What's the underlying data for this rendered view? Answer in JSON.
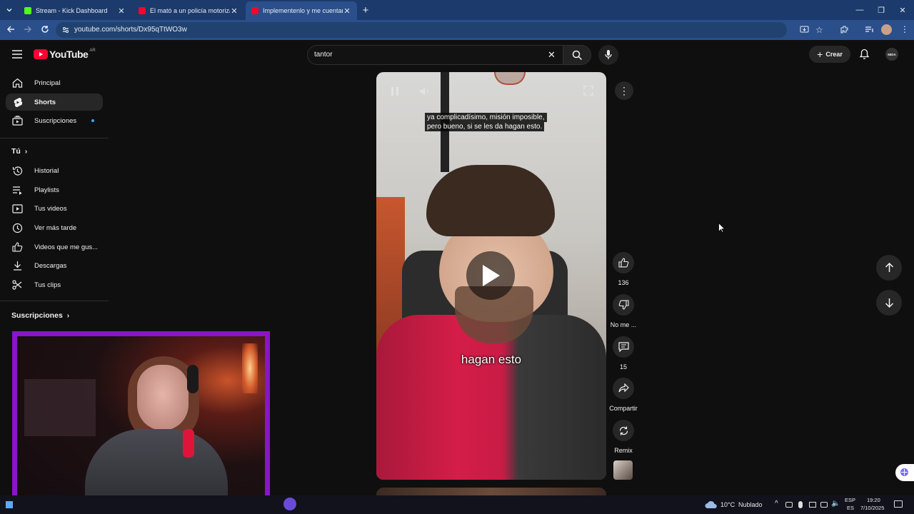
{
  "browser": {
    "tabs": [
      {
        "title": "Stream - Kick Dashboard",
        "favicon_color": "#53fc18"
      },
      {
        "title": "El mató a un policía motorizado",
        "favicon_color": "#ff0033"
      },
      {
        "title": "Implementenlo y me cuentan",
        "favicon_color": "#ff0033"
      }
    ],
    "new_tab_icon": "plus-icon",
    "url": "youtube.com/shorts/Dx95qTtWO3w"
  },
  "youtube": {
    "logo_text": "YouTube",
    "country": "AR",
    "search_value": "tantor",
    "create_label": "Crear",
    "avatar_text": "MIDA"
  },
  "sidebar": {
    "top": [
      {
        "label": "Principal",
        "icon": "home-icon"
      },
      {
        "label": "Shorts",
        "icon": "shorts-icon"
      },
      {
        "label": "Suscripciones",
        "icon": "subscriptions-icon"
      }
    ],
    "you_header": "Tú",
    "you": [
      {
        "label": "Historial",
        "icon": "history-icon"
      },
      {
        "label": "Playlists",
        "icon": "playlists-icon"
      },
      {
        "label": "Tus videos",
        "icon": "your-videos-icon"
      },
      {
        "label": "Ver más tarde",
        "icon": "watch-later-icon"
      },
      {
        "label": "Videos que me gus...",
        "icon": "liked-icon"
      },
      {
        "label": "Descargas",
        "icon": "download-icon"
      },
      {
        "label": "Tus clips",
        "icon": "clips-icon"
      }
    ],
    "subs_header": "Suscripciones"
  },
  "short": {
    "caption_line1": "ya complicadísimo, misión imposible,",
    "caption_line2": "pero bueno, si se les da hagan esto.",
    "subtitle": "hagan esto",
    "likes": "136",
    "dislike_label": "No me ...",
    "comments": "15",
    "share_label": "Compartir",
    "remix_label": "Remix"
  },
  "taskbar": {
    "temp": "10°C",
    "weather": "Nublado",
    "lang1": "ESP",
    "lang2": "ES",
    "time": "19:20",
    "date": "7/10/2025"
  }
}
